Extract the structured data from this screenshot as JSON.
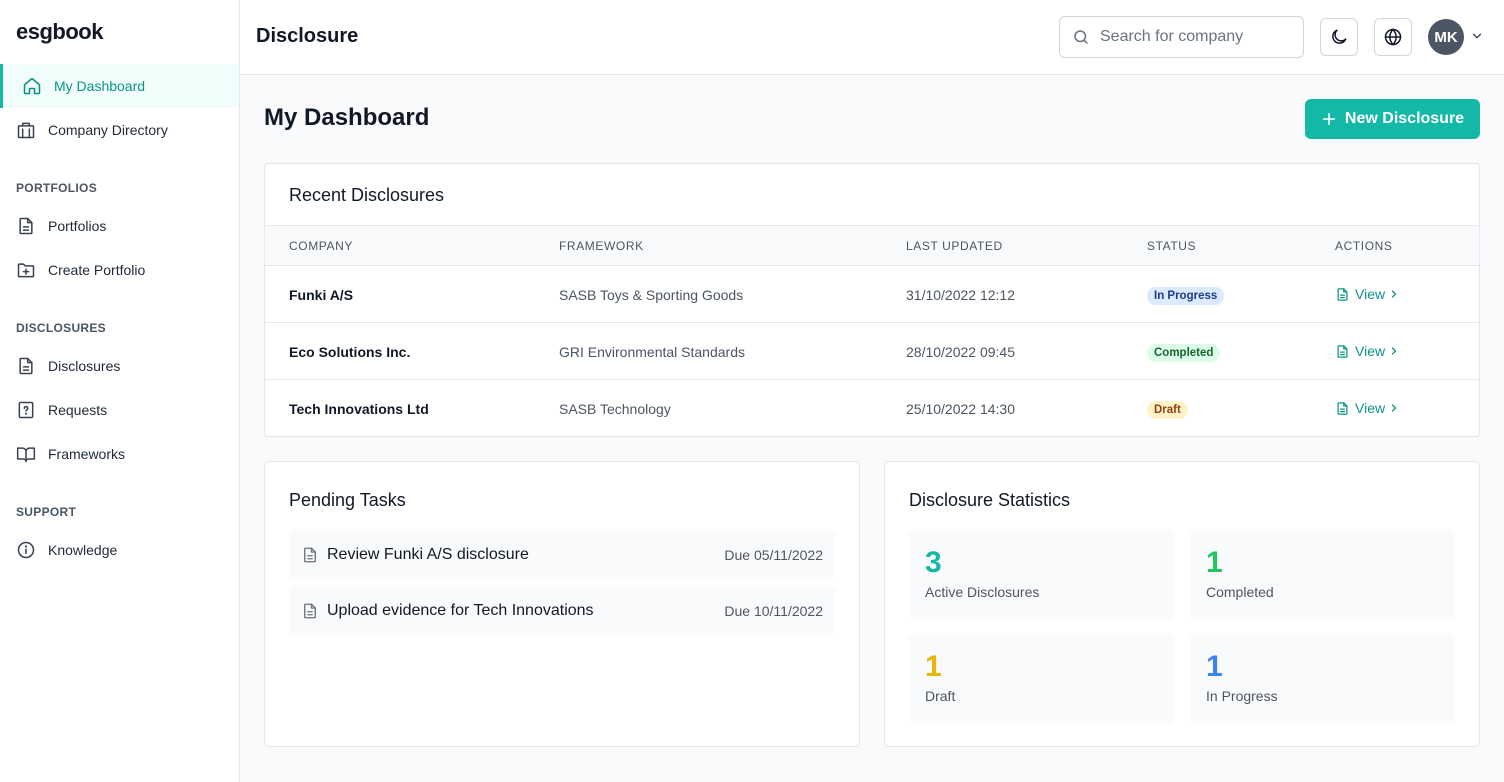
{
  "app": {
    "logo": "esgbook"
  },
  "sidebar": {
    "items": [
      {
        "label": "My Dashboard"
      },
      {
        "label": "Company Directory"
      }
    ],
    "sections": [
      {
        "title": "PORTFOLIOS",
        "items": [
          {
            "label": "Portfolios"
          },
          {
            "label": "Create Portfolio"
          }
        ]
      },
      {
        "title": "DISCLOSURES",
        "items": [
          {
            "label": "Disclosures"
          },
          {
            "label": "Requests"
          },
          {
            "label": "Frameworks"
          }
        ]
      },
      {
        "title": "SUPPORT",
        "items": [
          {
            "label": "Knowledge"
          }
        ]
      }
    ]
  },
  "header": {
    "title": "Disclosure",
    "search_placeholder": "Search for company",
    "avatar_initials": "MK"
  },
  "main": {
    "title": "My Dashboard",
    "new_button": "New Disclosure",
    "recent": {
      "title": "Recent Disclosures",
      "columns": [
        "COMPANY",
        "FRAMEWORK",
        "LAST UPDATED",
        "STATUS",
        "ACTIONS"
      ],
      "rows": [
        {
          "company": "Funki A/S",
          "framework": "SASB Toys & Sporting Goods",
          "updated": "31/10/2022 12:12",
          "status": "In Progress",
          "action": "View"
        },
        {
          "company": "Eco Solutions Inc.",
          "framework": "GRI Environmental Standards",
          "updated": "28/10/2022 09:45",
          "status": "Completed",
          "action": "View"
        },
        {
          "company": "Tech Innovations Ltd",
          "framework": "SASB Technology",
          "updated": "25/10/2022 14:30",
          "status": "Draft",
          "action": "View"
        }
      ]
    },
    "pending": {
      "title": "Pending Tasks",
      "tasks": [
        {
          "name": "Review Funki A/S disclosure",
          "due": "Due 05/11/2022"
        },
        {
          "name": "Upload evidence for Tech Innovations",
          "due": "Due 10/11/2022"
        }
      ]
    },
    "stats": {
      "title": "Disclosure Statistics",
      "items": [
        {
          "value": "3",
          "label": "Active Disclosures",
          "color": "#14b8a6"
        },
        {
          "value": "1",
          "label": "Completed",
          "color": "#22c55e"
        },
        {
          "value": "1",
          "label": "Draft",
          "color": "#eab308"
        },
        {
          "value": "1",
          "label": "In Progress",
          "color": "#3b82f6"
        }
      ]
    }
  }
}
